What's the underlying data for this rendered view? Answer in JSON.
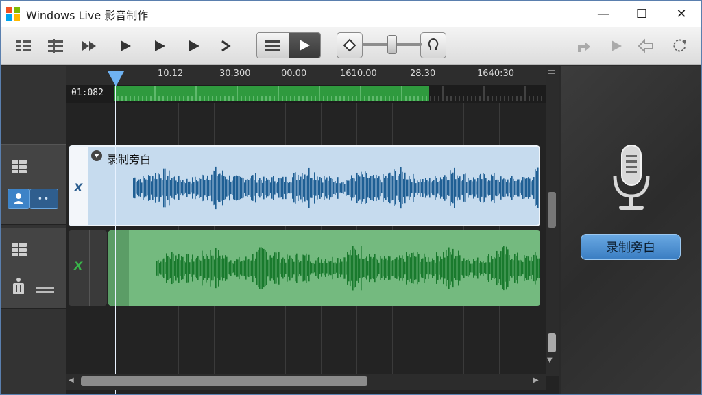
{
  "window": {
    "title": "Windows Live 影音制作",
    "minimize": "—",
    "maximize": "☐",
    "close": "✕"
  },
  "logo_colors": [
    "#f25022",
    "#7fba00",
    "#00a4ef",
    "#ffb900"
  ],
  "toolbar": {
    "icons": [
      "layout-icon",
      "split-icon",
      "fast-forward-icon",
      "play-icon",
      "play-icon",
      "play-icon",
      "next-icon"
    ],
    "view_icons": [
      "list-view-icon",
      "play-view-icon"
    ],
    "zoom_out_icon": "diamond-icon",
    "zoom_in_icon": "omega-icon",
    "right_icons": [
      "share-icon",
      "preview-play-icon",
      "export-icon",
      "refresh-icon"
    ]
  },
  "ruler": {
    "labels": [
      "10.12",
      "30.300",
      "00.00",
      "1610.00",
      "28.30",
      "1640:30"
    ]
  },
  "timebar": {
    "current_time": "01:082"
  },
  "tracks": {
    "narration": {
      "label": "录制旁白",
      "mute_glyph": "X"
    },
    "music": {
      "mute_glyph": "X"
    },
    "person_btn_dots": "••"
  },
  "colors": {
    "narration_wave": "#1f5f94",
    "music_wave": "#197a2d",
    "accent": "#3a7dc2"
  },
  "right_panel": {
    "mic_icon": "microphone-icon",
    "record_button": "录制旁白"
  }
}
